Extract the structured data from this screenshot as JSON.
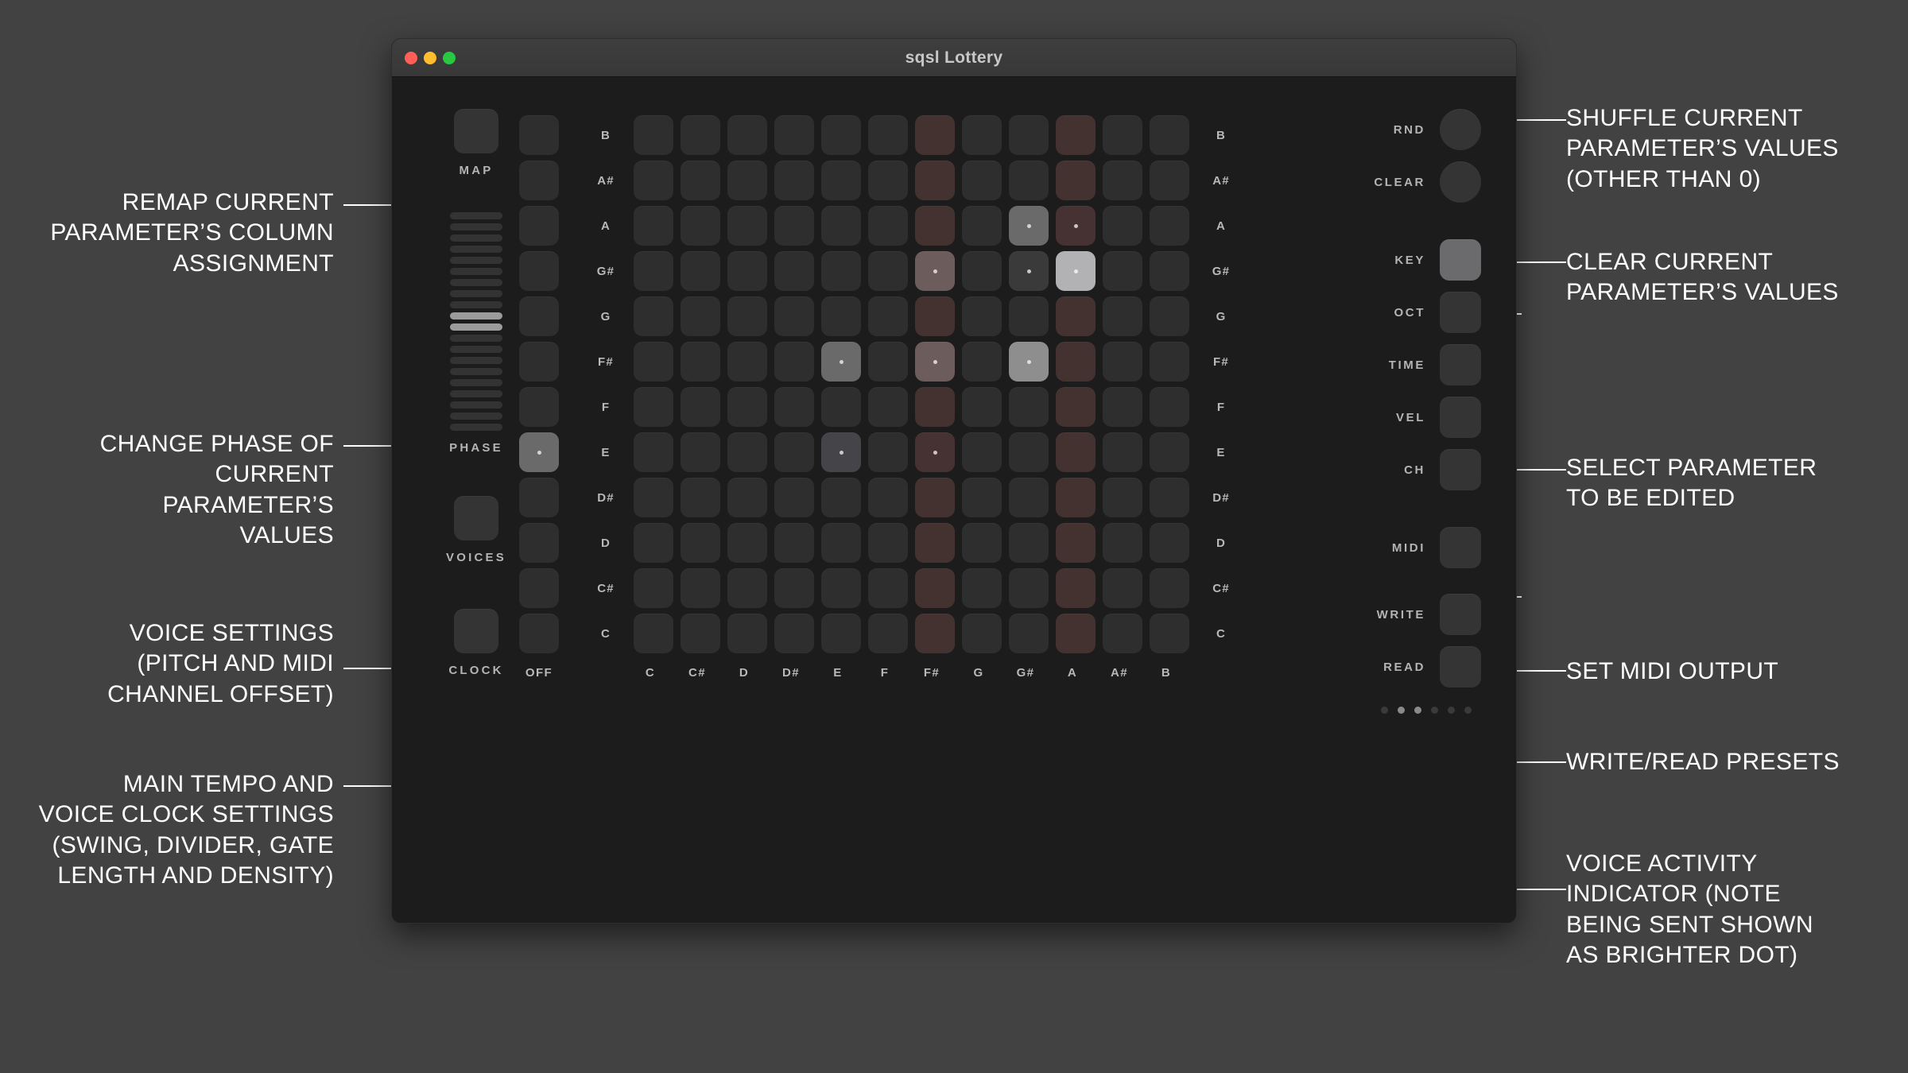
{
  "window": {
    "title": "sqsl Lottery",
    "traffic_lights": [
      "close-red",
      "minimize-yellow",
      "maximize-green"
    ]
  },
  "left_rail": {
    "map": {
      "label": "MAP"
    },
    "phase": {
      "label": "PHASE",
      "bar_count": 20,
      "active_bars": [
        9,
        10
      ]
    },
    "voices": {
      "label": "VOICES"
    },
    "clock": {
      "label": "CLOCK"
    }
  },
  "grid": {
    "column_labels": [
      "OFF",
      "C",
      "C#",
      "D",
      "D#",
      "E",
      "F",
      "F#",
      "G",
      "G#",
      "A",
      "A#",
      "B"
    ],
    "row_labels": [
      "B",
      "A#",
      "A",
      "G#",
      "G",
      "F#",
      "F",
      "E",
      "D#",
      "D",
      "C#",
      "C"
    ],
    "tinted_columns": [
      7,
      10
    ],
    "cells": {
      "B": {
        "tint": [
          7,
          10
        ],
        "lit": []
      },
      "A#": {
        "tint": [
          7,
          10
        ],
        "lit": []
      },
      "A": {
        "tint": [
          7,
          10
        ],
        "lit": [
          {
            "col": 9,
            "level": "mid",
            "dot": true
          },
          {
            "col": 10,
            "level": "tint-dot",
            "dot": true
          }
        ]
      },
      "G#": {
        "tint": [
          7,
          10
        ],
        "lit": [
          {
            "col": 7,
            "level": "warm",
            "dot": true
          },
          {
            "col": 9,
            "level": "dim",
            "dot": true
          },
          {
            "col": 10,
            "level": "bright",
            "dot": true
          }
        ]
      },
      "G": {
        "tint": [
          7,
          10
        ],
        "lit": []
      },
      "F#": {
        "tint": [
          7,
          10
        ],
        "lit": [
          {
            "col": 5,
            "level": "mid",
            "dot": true
          },
          {
            "col": 7,
            "level": "warm",
            "dot": true
          },
          {
            "col": 9,
            "level": "bright2",
            "dot": true
          }
        ]
      },
      "F": {
        "tint": [
          7,
          10
        ],
        "lit": []
      },
      "E": {
        "tint": [
          7,
          10
        ],
        "lit": [
          {
            "col": 0,
            "level": "mid",
            "dot": true
          },
          {
            "col": 5,
            "level": "dim2",
            "dot": true
          },
          {
            "col": 7,
            "level": "tint-dot",
            "dot": true
          }
        ]
      },
      "D#": {
        "tint": [
          7,
          10
        ],
        "lit": []
      },
      "D": {
        "tint": [
          7,
          10
        ],
        "lit": []
      },
      "C#": {
        "tint": [
          7,
          10
        ],
        "lit": []
      },
      "C": {
        "tint": [
          7,
          10
        ],
        "lit": []
      }
    }
  },
  "right_rail": {
    "actions": [
      {
        "label": "RND",
        "shape": "circle",
        "selected": false
      },
      {
        "label": "CLEAR",
        "shape": "circle",
        "selected": false
      }
    ],
    "parameters": [
      {
        "label": "KEY",
        "selected": true
      },
      {
        "label": "OCT",
        "selected": false
      },
      {
        "label": "TIME",
        "selected": false
      },
      {
        "label": "VEL",
        "selected": false
      },
      {
        "label": "CH",
        "selected": false
      }
    ],
    "midi": {
      "label": "MIDI",
      "selected": false
    },
    "presets": [
      {
        "label": "WRITE",
        "selected": false
      },
      {
        "label": "READ",
        "selected": false
      }
    ],
    "voice_activity": {
      "dot_count": 6,
      "active_dots": [
        1,
        2
      ]
    }
  },
  "annotations": {
    "left": [
      {
        "id": "remap",
        "text": "REMAP CURRENT\nPARAMETER’S COLUMN\nASSIGNMENT"
      },
      {
        "id": "phase",
        "text": "CHANGE PHASE OF\nCURRENT\nPARAMETER’S\nVALUES"
      },
      {
        "id": "voices",
        "text": "VOICE SETTINGS\n(PITCH AND MIDI\nCHANNEL OFFSET)"
      },
      {
        "id": "clock",
        "text": "MAIN TEMPO AND\nVOICE CLOCK SETTINGS\n(SWING, DIVIDER, GATE\nLENGTH AND DENSITY)"
      }
    ],
    "right": [
      {
        "id": "shuffle",
        "text": "SHUFFLE CURRENT\nPARAMETER’S VALUES\n(OTHER THAN 0)"
      },
      {
        "id": "clear",
        "text": "CLEAR CURRENT\nPARAMETER’S VALUES"
      },
      {
        "id": "select",
        "text": "SELECT PARAMETER\nTO BE EDITED"
      },
      {
        "id": "midi",
        "text": "SET MIDI OUTPUT"
      },
      {
        "id": "presets",
        "text": "WRITE/READ PRESETS"
      },
      {
        "id": "activity",
        "text": "VOICE ACTIVITY\nINDICATOR (NOTE\nBEING SENT SHOWN\nAS BRIGHTER DOT)"
      }
    ]
  },
  "colors": {
    "page_bg": "#424242",
    "window_bg": "#1c1c1c",
    "titlebar": "#3e3e3e",
    "cell_base": "#2e2e2e",
    "cell_tint": "#443231",
    "cell_mid": "#6a6a6a",
    "cell_bright": "#b2b2b5",
    "cell_warm": "#6d5c5c",
    "accent_text": "#ffffff",
    "label_text": "#b4b4b4"
  }
}
